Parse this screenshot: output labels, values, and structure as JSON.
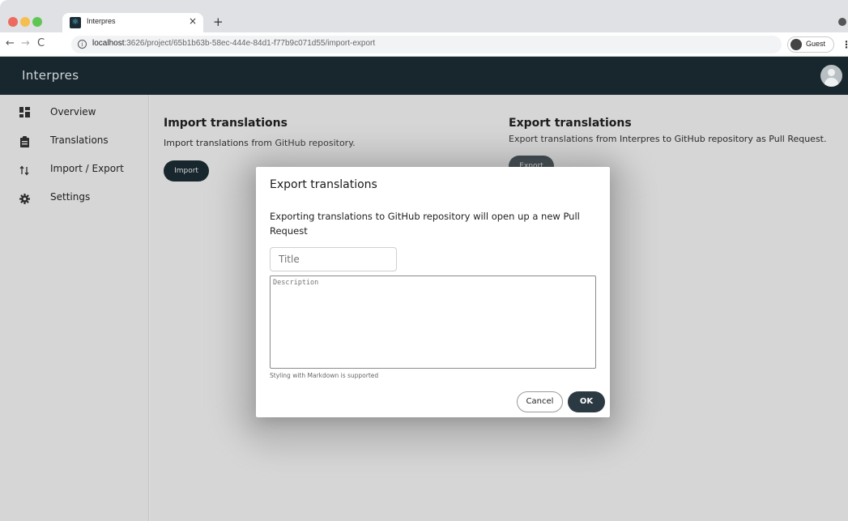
{
  "browser": {
    "tab_title": "Interpres",
    "tab_close": "×",
    "new_tab": "+",
    "url_host": "localhost",
    "url_rest": ":3626/project/65b1b63b-58ec-444e-84d1-f77b9c071d55/import-export",
    "profile_label": "Guest",
    "nav_back": "←",
    "nav_forward": "→",
    "nav_reload": "C",
    "info_glyph": "i",
    "menu_glyph": "⋮"
  },
  "app": {
    "brand": "Interpres"
  },
  "sidebar": {
    "items": [
      {
        "label": "Overview",
        "icon": "dashboard-icon"
      },
      {
        "label": "Translations",
        "icon": "clipboard-icon"
      },
      {
        "label": "Import / Export",
        "icon": "import-export-icon"
      },
      {
        "label": "Settings",
        "icon": "gear-icon"
      }
    ]
  },
  "import": {
    "title": "Import translations",
    "description": "Import translations from GitHub repository.",
    "button": "Import"
  },
  "export": {
    "title": "Export translations",
    "description": "Export translations from Interpres to GitHub repository as Pull Request.",
    "button": "Export"
  },
  "dialog": {
    "title": "Export translations",
    "body": "Exporting translations to GitHub repository will open up a new Pull Request",
    "title_placeholder": "Title",
    "description_placeholder": "Description",
    "helper": "Styling with Markdown is supported",
    "cancel": "Cancel",
    "ok": "OK"
  },
  "colors": {
    "appbar": "#18262d",
    "primary_button": "#2b3a42",
    "sidebar": "#d6d6d6"
  }
}
